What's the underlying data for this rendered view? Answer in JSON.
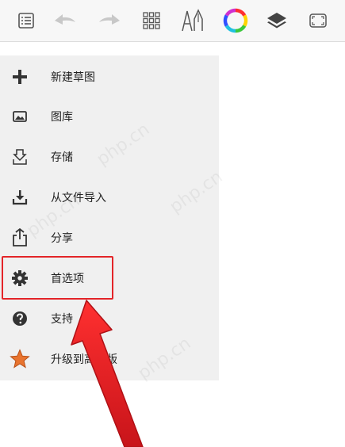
{
  "toolbar": {
    "buttons": [
      {
        "name": "list-icon"
      },
      {
        "name": "undo-arrow-icon"
      },
      {
        "name": "redo-arrow-icon"
      },
      {
        "name": "grid-icon"
      },
      {
        "name": "brush-pen-icon"
      },
      {
        "name": "color-wheel-icon"
      },
      {
        "name": "layers-icon"
      },
      {
        "name": "fullscreen-icon"
      }
    ]
  },
  "menu": {
    "items": [
      {
        "label": "新建草图",
        "icon": "plus-icon"
      },
      {
        "label": "图库",
        "icon": "gallery-icon"
      },
      {
        "label": "存储",
        "icon": "save-icon"
      },
      {
        "label": "从文件导入",
        "icon": "import-icon"
      },
      {
        "label": "分享",
        "icon": "share-icon"
      },
      {
        "label": "首选项",
        "icon": "gear-icon"
      },
      {
        "label": "支持",
        "icon": "help-icon"
      },
      {
        "label": "升级到高级版",
        "icon": "star-icon"
      }
    ]
  },
  "annotation": {
    "color": "#e32428"
  },
  "watermark": {
    "text": "php.cn"
  }
}
